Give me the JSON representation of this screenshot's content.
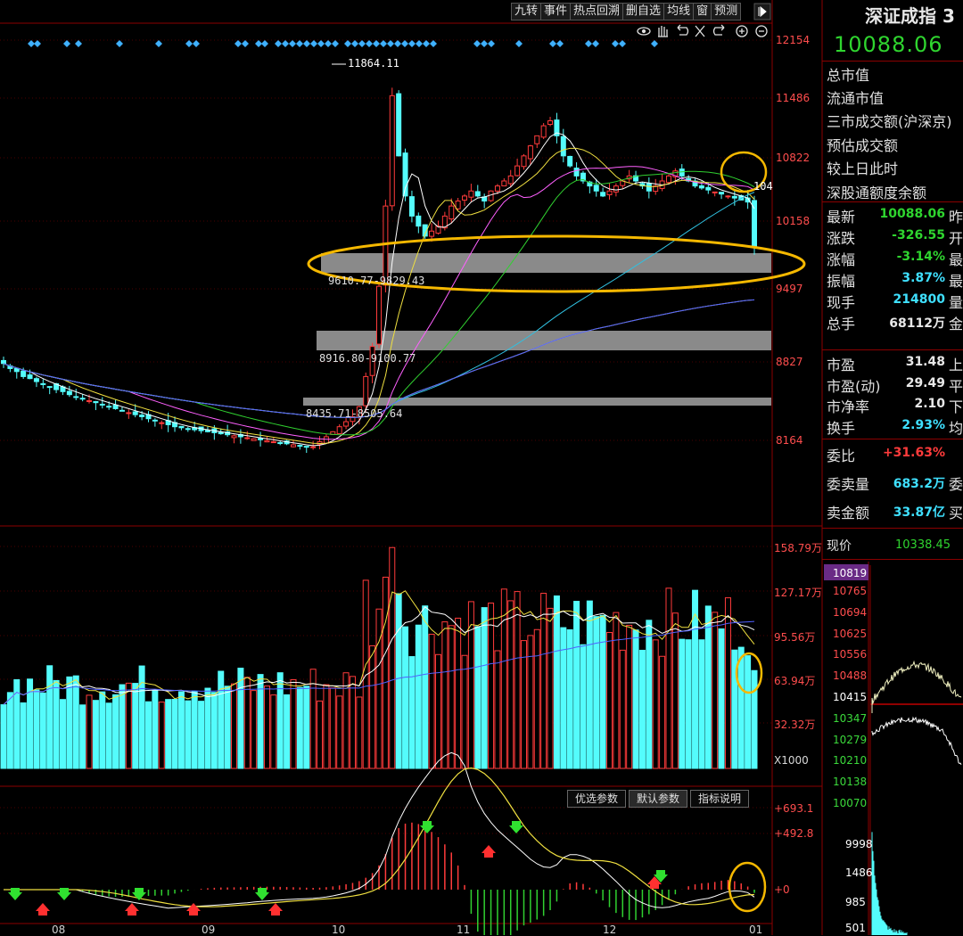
{
  "toolbar": {
    "buttons": [
      "九转",
      "事件",
      "热点回溯",
      "删自选",
      "均线",
      "窗",
      "预测"
    ]
  },
  "main_chart": {
    "high_label": "11864.11",
    "ma_value_cut": "104",
    "price_axis": [
      "12154",
      "11486",
      "10822",
      "10158",
      "9497",
      "8827",
      "8164"
    ],
    "gap_ranges": [
      "9610.77-9829.43",
      "8916.80-9100.77",
      "8435.71-8505.64"
    ]
  },
  "volume": {
    "axis": [
      "158.79万",
      "127.17万",
      "95.56万",
      "63.94万",
      "32.32万",
      "X1000"
    ]
  },
  "indicator": {
    "tabs": [
      "优选参数",
      "默认参数",
      "指标说明"
    ],
    "axis": [
      "+693.1",
      "+492.8",
      "+0"
    ]
  },
  "x_axis": [
    "08",
    "09",
    "10",
    "11",
    "12",
    "01"
  ],
  "quote_panel": {
    "title": "深证成指",
    "title_cut": "3",
    "last_price": "10088.06",
    "rows_top": [
      "总市值",
      "流通市值",
      "三市成交额(沪深京)",
      "预估成交额",
      "较上日此时",
      "深股通额度余额"
    ],
    "stats": [
      {
        "label": "最新",
        "value": "10088.06",
        "cut": "昨",
        "color": "g"
      },
      {
        "label": "涨跌",
        "value": "-326.55",
        "cut": "开",
        "color": "g"
      },
      {
        "label": "涨幅",
        "value": "-3.14%",
        "cut": "最",
        "color": "g"
      },
      {
        "label": "振幅",
        "value": "3.87%",
        "cut": "最",
        "color": "c"
      },
      {
        "label": "现手",
        "value": "214800",
        "cut": "量",
        "color": "c"
      },
      {
        "label": "总手",
        "value": "68112万",
        "cut": "金",
        "color": "w"
      }
    ],
    "valuation": [
      {
        "label": "市盈",
        "value": "31.48",
        "cut": "上",
        "color": "w"
      },
      {
        "label": "市盈(动)",
        "value": "29.49",
        "cut": "平",
        "color": "w"
      },
      {
        "label": "市净率",
        "value": "2.10",
        "cut": "下",
        "color": "w"
      },
      {
        "label": "换手",
        "value": "2.93%",
        "cut": "均",
        "color": "c"
      }
    ],
    "orders": [
      {
        "label": "委比",
        "value": "+31.63%",
        "cut": "",
        "color": "r"
      },
      {
        "label": "委卖量",
        "value": "683.2万",
        "cut": "委",
        "color": "c"
      },
      {
        "label": "卖金额",
        "value": "33.87亿",
        "cut": "买",
        "color": "c"
      }
    ],
    "current_label": "现价",
    "current_value": "10338.45"
  },
  "intraday": {
    "highlight": "10819",
    "axis": [
      "10765",
      "10694",
      "10625",
      "10556",
      "10488",
      "10415",
      "10347",
      "10279",
      "10210",
      "10138",
      "10070"
    ],
    "vol_axis": [
      "9998",
      "1486",
      "985",
      "501"
    ]
  },
  "chart_data": {
    "type": "candlestick",
    "x_ticks": [
      "08",
      "09",
      "10",
      "11",
      "12",
      "01"
    ],
    "y_ticks": [
      12154,
      11486,
      10822,
      10158,
      9497,
      8827,
      8164
    ],
    "ylim": [
      7600,
      12400
    ],
    "annotations": [
      "11864.11",
      "9610.77-9829.43",
      "8916.80-9100.77",
      "8435.71-8505.64"
    ],
    "closes_approx": [
      8930,
      8880,
      8850,
      8800,
      8780,
      8750,
      8720,
      8700,
      8670,
      8650,
      8620,
      8600,
      8580,
      8560,
      8540,
      8520,
      8500,
      8480,
      8460,
      8440,
      8420,
      8400,
      8380,
      8360,
      8340,
      8320,
      8300,
      8290,
      8280,
      8270,
      8260,
      8250,
      8240,
      8230,
      8220,
      8210,
      8200,
      8190,
      8180,
      8170,
      8160,
      8150,
      8140,
      8130,
      8120,
      8110,
      8100,
      8100,
      8150,
      8200,
      8250,
      8300,
      8350,
      8400,
      8500,
      8800,
      9100,
      9700,
      10500,
      11600,
      11000,
      10600,
      10400,
      10300,
      10200,
      10250,
      10300,
      10400,
      10500,
      10550,
      10600,
      10650,
      10600,
      10550,
      10650,
      10700,
      10750,
      10800,
      10900,
      11000,
      11100,
      11200,
      11300,
      11350,
      11200,
      11000,
      10900,
      10800,
      10750,
      10700,
      10650,
      10600,
      10650,
      10700,
      10750,
      10800,
      10750,
      10700,
      10650,
      10700,
      10750,
      10800,
      10850,
      10800,
      10750,
      10700,
      10680,
      10660,
      10640,
      10620,
      10600,
      10580,
      10560,
      10540,
      10088
    ]
  }
}
